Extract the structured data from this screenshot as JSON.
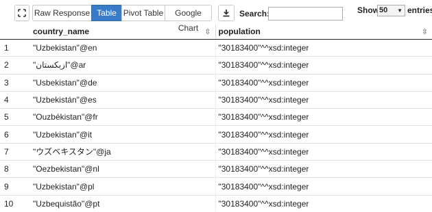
{
  "toolbar": {
    "expand_icon": "expand-arrows-icon",
    "tabs": [
      {
        "label": "Raw Response",
        "active": false
      },
      {
        "label": "Table",
        "active": true
      },
      {
        "label": "Pivot Table",
        "active": false
      },
      {
        "label": "Google Chart",
        "active": false
      }
    ],
    "download_icon": "download-icon",
    "search_label": "Search:",
    "search_value": "",
    "show_label": "Show",
    "show_value": "50",
    "entries_label": "entries"
  },
  "table": {
    "columns": [
      "country_name",
      "population"
    ],
    "rows": [
      {
        "index": "1",
        "country_name": "\"Uzbekistan\"@en",
        "population": "\"30183400\"^^xsd:integer"
      },
      {
        "index": "2",
        "country_name": "\"ازبکستان\"@ar",
        "population": "\"30183400\"^^xsd:integer"
      },
      {
        "index": "3",
        "country_name": "\"Usbekistan\"@de",
        "population": "\"30183400\"^^xsd:integer"
      },
      {
        "index": "4",
        "country_name": "\"Uzbekistán\"@es",
        "population": "\"30183400\"^^xsd:integer"
      },
      {
        "index": "5",
        "country_name": "\"Ouzbékistan\"@fr",
        "population": "\"30183400\"^^xsd:integer"
      },
      {
        "index": "6",
        "country_name": "\"Uzbekistan\"@it",
        "population": "\"30183400\"^^xsd:integer"
      },
      {
        "index": "7",
        "country_name": "\"ウズベキスタン\"@ja",
        "population": "\"30183400\"^^xsd:integer"
      },
      {
        "index": "8",
        "country_name": "\"Oezbekistan\"@nl",
        "population": "\"30183400\"^^xsd:integer"
      },
      {
        "index": "9",
        "country_name": "\"Uzbekistan\"@pl",
        "population": "\"30183400\"^^xsd:integer"
      },
      {
        "index": "10",
        "country_name": "\"Uzbequistão\"@pt",
        "population": "\"30183400\"^^xsd:integer"
      }
    ]
  }
}
